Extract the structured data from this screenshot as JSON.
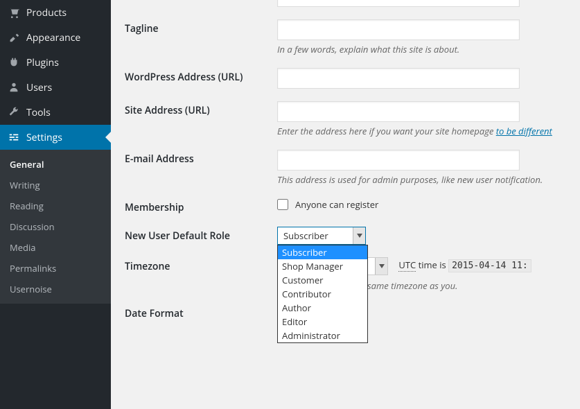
{
  "sidebar": {
    "items": [
      {
        "label": "Products"
      },
      {
        "label": "Appearance"
      },
      {
        "label": "Plugins"
      },
      {
        "label": "Users"
      },
      {
        "label": "Tools"
      },
      {
        "label": "Settings"
      }
    ],
    "submenu": [
      {
        "label": "General"
      },
      {
        "label": "Writing"
      },
      {
        "label": "Reading"
      },
      {
        "label": "Discussion"
      },
      {
        "label": "Media"
      },
      {
        "label": "Permalinks"
      },
      {
        "label": "Usernoise"
      }
    ]
  },
  "form": {
    "tagline": {
      "label": "Tagline",
      "value": "",
      "desc": "In a few words, explain what this site is about."
    },
    "wpaddr": {
      "label": "WordPress Address (URL)",
      "value": ""
    },
    "siteaddr": {
      "label": "Site Address (URL)",
      "value": "",
      "desc_prefix": "Enter the address here if you want your site homepage ",
      "desc_link": "to be different"
    },
    "email": {
      "label": "E-mail Address",
      "value": "",
      "desc": "This address is used for admin purposes, like new user notification."
    },
    "membership": {
      "label": "Membership",
      "checkbox_label": "Anyone can register"
    },
    "role": {
      "label": "New User Default Role",
      "selected": "Subscriber",
      "options": [
        "Subscriber",
        "Shop Manager",
        "Customer",
        "Contributor",
        "Author",
        "Editor",
        "Administrator"
      ]
    },
    "timezone": {
      "label": "Timezone",
      "utc_abbr": "UTC",
      "utc_suffix": " time is ",
      "code": "2015-04-14 11:",
      "desc": "same timezone as you."
    },
    "dateformat": {
      "label": "Date Format"
    }
  }
}
